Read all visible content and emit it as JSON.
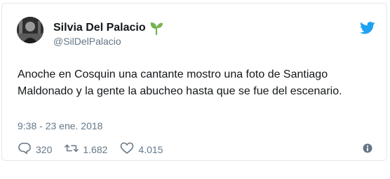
{
  "author": {
    "name": "Silvia Del Palacio",
    "handle": "@SilDelPalacio",
    "badge_icon": "sprout-icon",
    "avatar_icon": "avatar"
  },
  "tweet": {
    "text": "Anoche en Cosquin una cantante mostro una foto de Santiago Maldonado y la gente la abucheo hasta que se fue del escenario.",
    "timestamp": "9:38 - 23 ene. 2018"
  },
  "actions": {
    "replies": "320",
    "retweets": "1.682",
    "likes": "4.015"
  },
  "colors": {
    "twitter_blue": "#1da1f2",
    "text_primary": "#14171a",
    "text_secondary": "#657786",
    "sprout_green": "#77b255"
  }
}
